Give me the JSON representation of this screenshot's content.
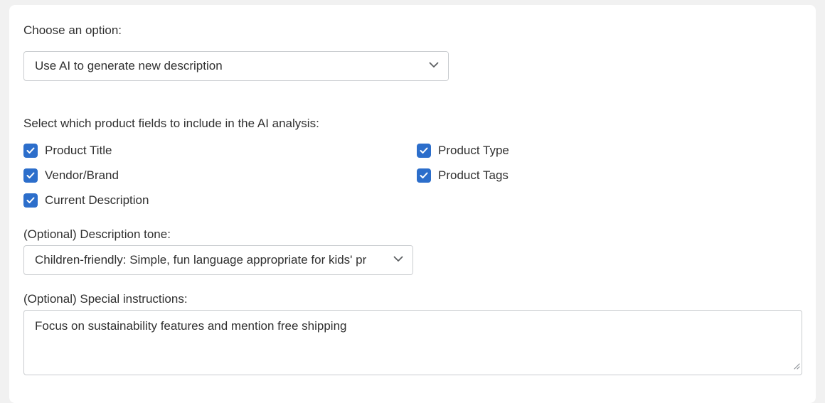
{
  "option": {
    "label": "Choose an option:",
    "selected": "Use AI to generate new description"
  },
  "fields": {
    "label": "Select which product fields to include in the AI analysis:",
    "items": [
      {
        "label": "Product Title",
        "checked": true
      },
      {
        "label": "Product Type",
        "checked": true
      },
      {
        "label": "Vendor/Brand",
        "checked": true
      },
      {
        "label": "Product Tags",
        "checked": true
      },
      {
        "label": "Current Description",
        "checked": true
      }
    ]
  },
  "tone": {
    "label": "(Optional) Description tone:",
    "selected": "Children-friendly: Simple, fun language appropriate for kids' pr"
  },
  "instructions": {
    "label": "(Optional) Special instructions:",
    "value": "Focus on sustainability features and mention free shipping"
  },
  "colors": {
    "accent": "#2c6ecb",
    "border": "#c9cccf",
    "text": "#303030"
  },
  "icons": {
    "select_chevron": "chevron-down-icon",
    "checkbox_mark": "checkmark-icon",
    "resize_handle": "resize-grip-icon"
  }
}
